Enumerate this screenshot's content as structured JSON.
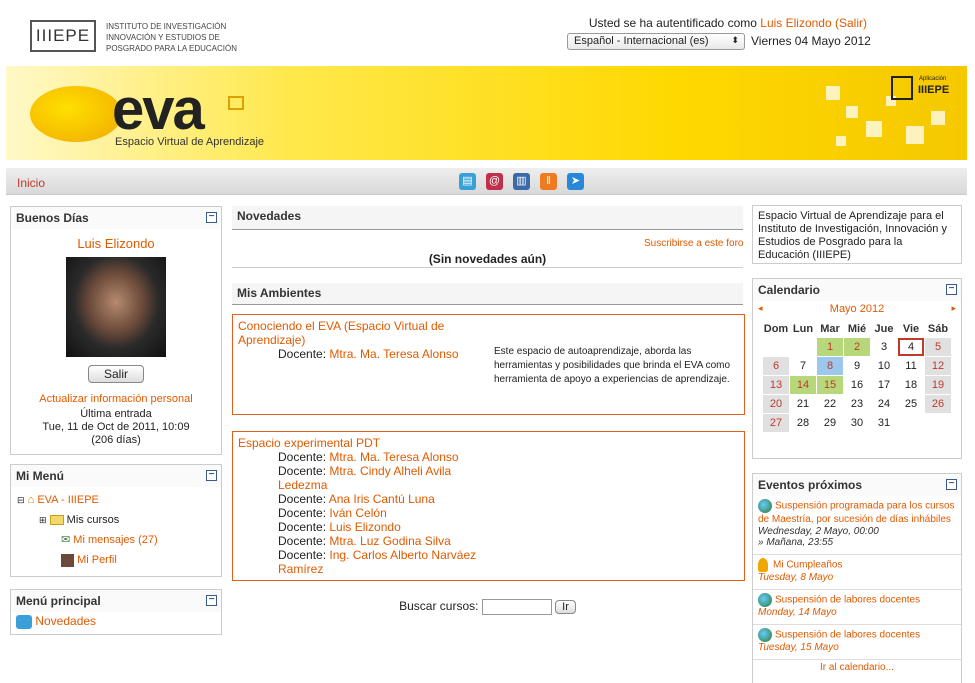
{
  "header": {
    "logo_text": "IIIEPE",
    "institute_lines": [
      "INSTITUTO DE INVESTIGACIÓN",
      "INNOVACIÓN Y ESTUDIOS DE",
      "POSGRADO PARA LA EDUCACIÓN"
    ],
    "auth_prefix": "Usted se ha autentificado como",
    "auth_user": "Luis Elizondo",
    "auth_logout": "(Salir)",
    "language": "Español - Internacional (es)",
    "date": "Viernes 04 Mayo 2012"
  },
  "banner": {
    "brand": "eva",
    "subtitle": "Espacio Virtual de Aprendizaje",
    "app_small": "Aplicación",
    "app_name": "IIIEPE"
  },
  "nav": {
    "home": "Inicio",
    "icons": [
      "chat-icon",
      "mail-icon",
      "books-icon",
      "tools-icon",
      "arrow-icon"
    ]
  },
  "left": {
    "greeting_block": {
      "title": "Buenos Días",
      "user_name": "Luis Elizondo",
      "logout_button": "Salir",
      "update_link": "Actualizar información personal",
      "last_entry_label": "Última entrada",
      "last_entry_date": "Tue, 11 de Oct de 2011, 10:09",
      "last_entry_days": "(206 días)"
    },
    "my_menu": {
      "title": "Mi Menú",
      "root": "EVA - IIIEPE",
      "items": [
        "Mis cursos",
        "Mi mensajes (27)",
        "Mi Perfil"
      ]
    },
    "main_menu": {
      "title": "Menú principal",
      "item": "Novedades"
    }
  },
  "center": {
    "news": {
      "title": "Novedades",
      "subscribe": "Suscribirse a este foro",
      "empty": "(Sin novedades aún)"
    },
    "environments": {
      "title": "Mis Ambientes",
      "doc_label": "Docente:",
      "courses": [
        {
          "title": "Conociendo el EVA (Espacio Virtual de Aprendizaje)",
          "teachers": [
            "Mtra. Ma. Teresa Alonso"
          ],
          "summary": "Este espacio de autoaprendizaje, aborda las herramientas y posibilidades que brinda el EVA como herramienta de apoyo a experiencias de aprendizaje."
        },
        {
          "title": "Espacio experimental PDT",
          "teachers": [
            "Mtra. Ma. Teresa Alonso",
            "Mtra. Cindy Alheli Avila Ledezma",
            "Ana Iris Cantú Luna",
            "Iván Celón",
            "Luis Elizondo",
            "Mtra. Luz Godina Silva",
            "Ing. Carlos Alberto Narváez Ramírez"
          ],
          "summary": ""
        }
      ]
    },
    "search": {
      "label": "Buscar cursos:",
      "button": "Ir",
      "value": ""
    }
  },
  "right": {
    "description": "Espacio Virtual de Aprendizaje para el Instituto de Investigación, Innovación y Estudios de Posgrado para la Educación (IIIEPE)",
    "calendar": {
      "title": "Calendario",
      "month": "Mayo 2012",
      "prev": "◂",
      "next": "▸",
      "days": [
        "Dom",
        "Lun",
        "Mar",
        "Mié",
        "Jue",
        "Vie",
        "Sáb"
      ],
      "weeks": [
        [
          "",
          "",
          "1",
          "2",
          "3",
          "4",
          "5"
        ],
        [
          "6",
          "7",
          "8",
          "9",
          "10",
          "11",
          "12"
        ],
        [
          "13",
          "14",
          "15",
          "16",
          "17",
          "18",
          "19"
        ],
        [
          "20",
          "21",
          "22",
          "23",
          "24",
          "25",
          "26"
        ],
        [
          "27",
          "28",
          "29",
          "30",
          "31",
          "",
          ""
        ]
      ]
    },
    "events": {
      "title": "Eventos próximos",
      "items": [
        {
          "icon": "globe-icon",
          "title": "Suspensión programada para los cursos de Maestría, por sucesión de días inhábiles",
          "date": "Wednesday, 2 Mayo, 00:00",
          "date2": "» Mañana, 23:55"
        },
        {
          "icon": "medal-icon",
          "title": "Mi Cumpleaños",
          "date": "Tuesday, 8 Mayo",
          "date2": ""
        },
        {
          "icon": "globe-icon",
          "title": "Suspensión de labores docentes",
          "date": "Monday, 14 Mayo",
          "date2": ""
        },
        {
          "icon": "globe-icon",
          "title": "Suspensión de labores docentes",
          "date": "Tuesday, 15 Mayo",
          "date2": ""
        }
      ],
      "footer": "Ir al calendario..."
    }
  }
}
